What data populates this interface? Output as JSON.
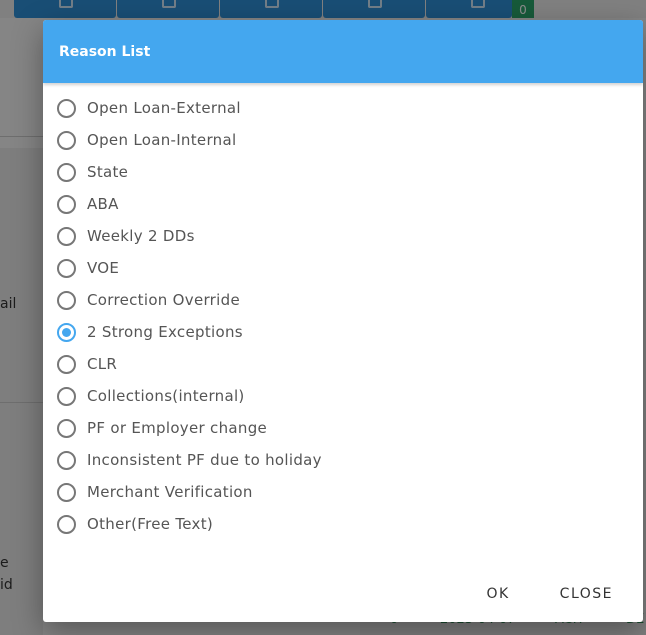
{
  "background": {
    "toolbar_badge": "0",
    "left_fragments": [
      "ail",
      "e",
      "id"
    ],
    "footer_fragments": [
      "0",
      "2023-04-07",
      "ACH",
      "DE"
    ]
  },
  "dialog": {
    "title": "Reason List",
    "options": [
      {
        "label": "Open Loan-External",
        "checked": false
      },
      {
        "label": "Open Loan-Internal",
        "checked": false
      },
      {
        "label": "State",
        "checked": false
      },
      {
        "label": "ABA",
        "checked": false
      },
      {
        "label": "Weekly 2 DDs",
        "checked": false
      },
      {
        "label": "VOE",
        "checked": false
      },
      {
        "label": "Correction Override",
        "checked": false
      },
      {
        "label": "2 Strong Exceptions",
        "checked": true
      },
      {
        "label": "CLR",
        "checked": false
      },
      {
        "label": "Collections(internal)",
        "checked": false
      },
      {
        "label": "PF or Employer change",
        "checked": false
      },
      {
        "label": "Inconsistent PF due to holiday",
        "checked": false
      },
      {
        "label": "Merchant Verification",
        "checked": false
      },
      {
        "label": "Other(Free Text)",
        "checked": false
      }
    ],
    "ok_label": "OK",
    "close_label": "CLOSE"
  },
  "colors": {
    "header": "#44a7ef",
    "radio_checked": "#44a7ef",
    "badge": "#2aa56a"
  }
}
